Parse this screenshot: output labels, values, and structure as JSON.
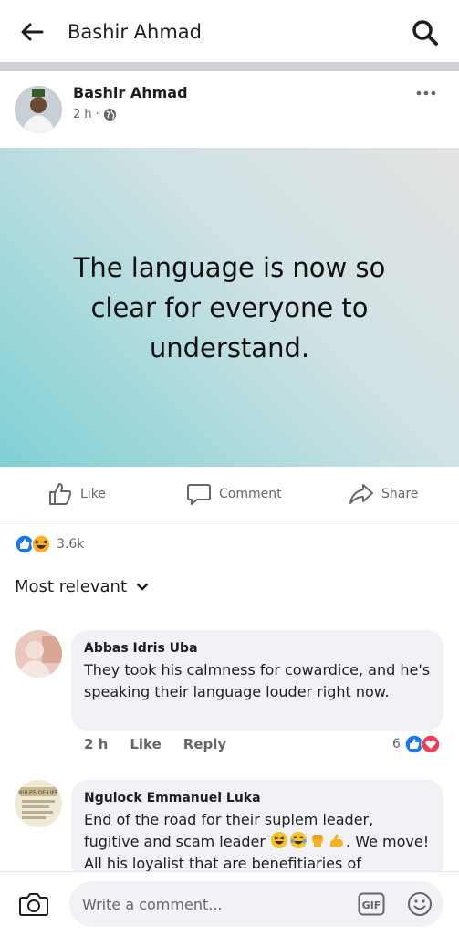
{
  "topbar": {
    "title": "Bashir Ahmad",
    "back_icon": "arrow-left-icon",
    "search_icon": "search-icon"
  },
  "post": {
    "author": "Bashir Ahmad",
    "time": "2 h",
    "audience_icon": "globe-icon",
    "text": "The language is now so clear for everyone to understand.",
    "actions": {
      "like": "Like",
      "comment": "Comment",
      "share": "Share"
    },
    "reaction_count": "3.6k"
  },
  "comments_section": {
    "sort_label": "Most relevant",
    "comments": [
      {
        "name": "Abbas Idris Uba",
        "text": "They took his calmness for cowardice, and he's speaking their language louder right now.",
        "time": "2 h",
        "like_label": "Like",
        "reply_label": "Reply",
        "reaction_count": "6"
      },
      {
        "name": "Ngulock Emmanuel Luka",
        "text_start": "End of the road for their suplem leader, fugitive and scam leader ",
        "text_end": ". We move! All his loyalist that are benefitiaries of",
        "avatar_text": "RULES OF LIFE"
      }
    ]
  },
  "composer": {
    "placeholder": "Write a comment...",
    "gif_label": "GIF"
  },
  "colors": {
    "like_blue": "#1877f2",
    "love_red": "#f33e58",
    "haha_yellow": "#f7b125",
    "text_secondary": "#65676b",
    "bubble_bg": "#f0f2f5"
  }
}
